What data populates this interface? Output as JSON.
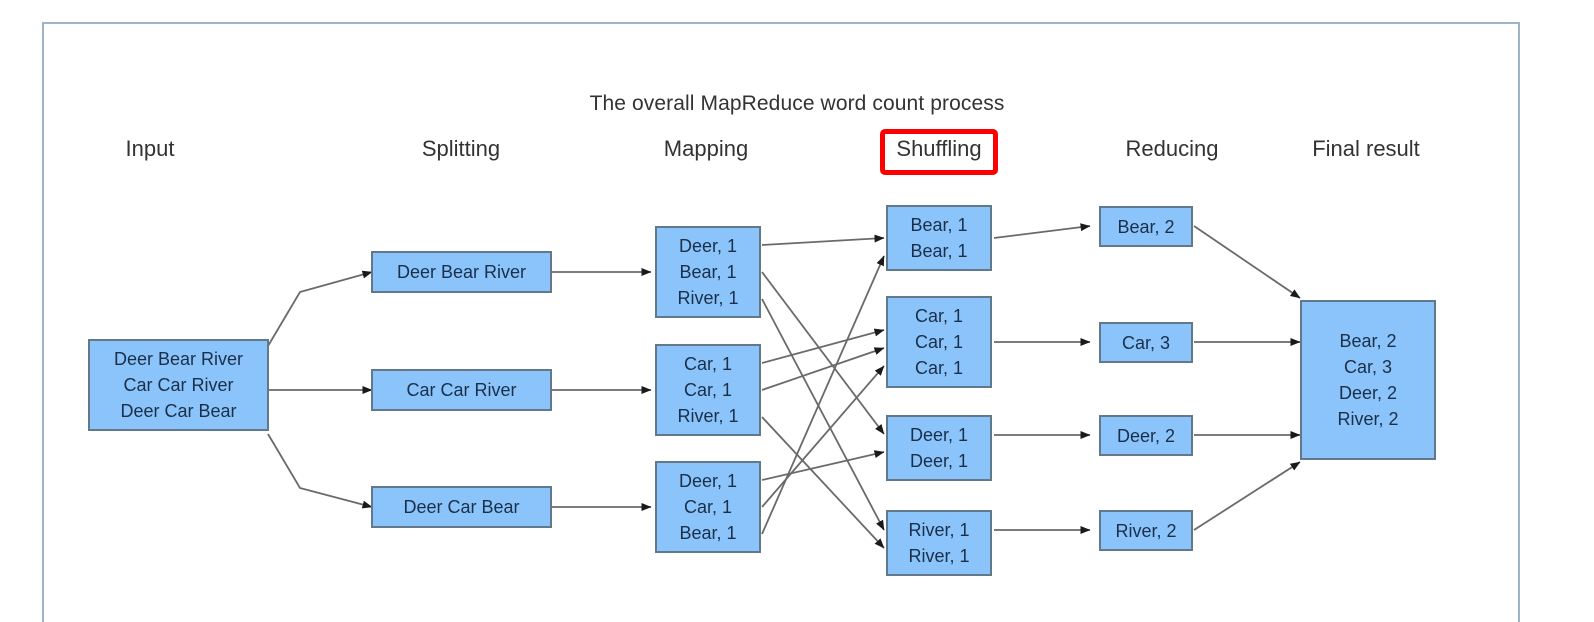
{
  "diagram": {
    "title": "The overall MapReduce word count process",
    "frame_color": "#9fb4c4",
    "node_fill": "#8ac4fa",
    "node_stroke": "#62798c",
    "highlight_color": "#ff0000",
    "columns": [
      {
        "id": "input",
        "label": "Input"
      },
      {
        "id": "splitting",
        "label": "Splitting"
      },
      {
        "id": "mapping",
        "label": "Mapping"
      },
      {
        "id": "shuffling",
        "label": "Shuffling",
        "highlighted": true
      },
      {
        "id": "reducing",
        "label": "Reducing"
      },
      {
        "id": "final_result",
        "label": "Final result"
      }
    ],
    "nodes": {
      "input": [
        {
          "id": "input-0",
          "lines": [
            "Deer Bear River",
            "Car Car River",
            "Deer Car Bear"
          ]
        }
      ],
      "splitting": [
        {
          "id": "split-0",
          "lines": [
            "Deer Bear River"
          ]
        },
        {
          "id": "split-1",
          "lines": [
            "Car Car River"
          ]
        },
        {
          "id": "split-2",
          "lines": [
            "Deer Car Bear"
          ]
        }
      ],
      "mapping": [
        {
          "id": "map-0",
          "lines": [
            "Deer, 1",
            "Bear, 1",
            "River, 1"
          ]
        },
        {
          "id": "map-1",
          "lines": [
            "Car, 1",
            "Car, 1",
            "River, 1"
          ]
        },
        {
          "id": "map-2",
          "lines": [
            "Deer, 1",
            "Car, 1",
            "Bear, 1"
          ]
        }
      ],
      "shuffling": [
        {
          "id": "shuffle-0",
          "lines": [
            "Bear, 1",
            "Bear, 1"
          ]
        },
        {
          "id": "shuffle-1",
          "lines": [
            "Car, 1",
            "Car, 1",
            "Car, 1"
          ]
        },
        {
          "id": "shuffle-2",
          "lines": [
            "Deer, 1",
            "Deer, 1"
          ]
        },
        {
          "id": "shuffle-3",
          "lines": [
            "River, 1",
            "River, 1"
          ]
        }
      ],
      "reducing": [
        {
          "id": "reduce-0",
          "lines": [
            "Bear, 2"
          ]
        },
        {
          "id": "reduce-1",
          "lines": [
            "Car, 3"
          ]
        },
        {
          "id": "reduce-2",
          "lines": [
            "Deer, 2"
          ]
        },
        {
          "id": "reduce-3",
          "lines": [
            "River, 2"
          ]
        }
      ],
      "final_result": [
        {
          "id": "final-0",
          "lines": [
            "Bear, 2",
            "Car, 3",
            "Deer, 2",
            "River, 2"
          ]
        }
      ]
    }
  }
}
